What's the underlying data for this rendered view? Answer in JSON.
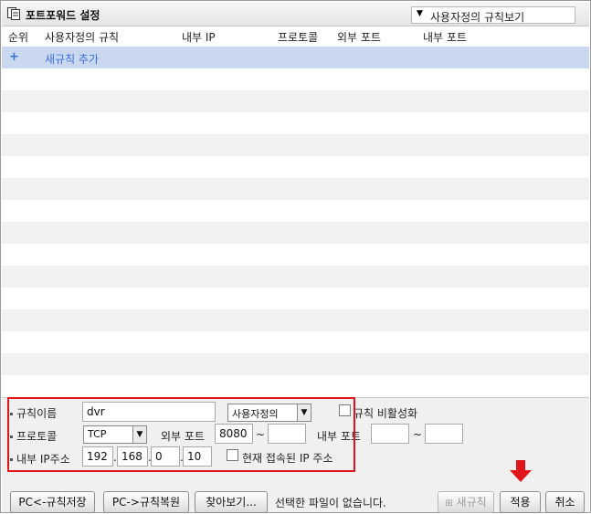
{
  "header": {
    "title": "포트포워드 설정",
    "view_select": "사용자정의 규칙보기"
  },
  "columns": [
    "순위",
    "사용자정의 규칙",
    "내부 IP",
    "프로토콜",
    "외부 포트",
    "내부 포트"
  ],
  "table": {
    "add_rule_icon": "+",
    "add_rule_label": "새규칙 추가"
  },
  "form": {
    "rule_name_label": "규칙이름",
    "rule_name_value": "dvr",
    "rule_type_select": "사용자정의",
    "disable_rule_label": "규칙 비활성화",
    "protocol_label": "프로토콜",
    "protocol_select": "TCP",
    "ext_port_label": "외부 포트",
    "ext_port_from": "8080",
    "ext_port_to": "",
    "int_port_label": "내부 포트",
    "int_port_from": "",
    "int_port_to": "",
    "range_sep": "~",
    "ip_label": "내부 IP주소",
    "ip": [
      "192",
      "168",
      "0",
      "10"
    ],
    "ip_dot": ".",
    "current_ip_label": "현재 접속된 IP 주소"
  },
  "footer": {
    "backup_button": "PC<-규칙저장",
    "restore_button": "PC->규칙복원",
    "browse_button": "찾아보기...",
    "no_file_text": "선택한 파일이 없습니다.",
    "new_rule_button": "새규칙",
    "apply_button": "적용",
    "cancel_button": "취소"
  },
  "colors": {
    "selected_row": "#c9d7ef",
    "link_blue": "#3a6fd8",
    "highlight_red": "#e0151c"
  }
}
